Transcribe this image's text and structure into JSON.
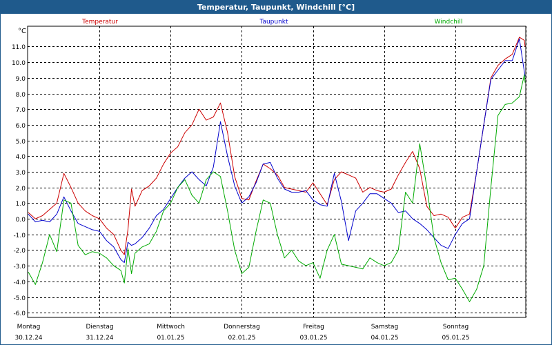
{
  "window": {
    "title": "Temperatur, Taupunkt, Windchill [°C]"
  },
  "chart_data": {
    "type": "line",
    "title": "Temperatur, Taupunkt, Windchill [°C]",
    "ylabel": "°C",
    "ylim": [
      -6.3,
      12.3
    ],
    "yticks": [
      11.0,
      10.0,
      9.0,
      8.0,
      7.0,
      6.0,
      5.0,
      4.0,
      3.0,
      2.0,
      1.0,
      0.0,
      -1.0,
      -2.0,
      -3.0,
      -4.0,
      -5.0,
      -6.0
    ],
    "xlim": [
      0,
      7
    ],
    "xticks": [
      {
        "x": 0,
        "day": "Montag",
        "date": "30.12.24"
      },
      {
        "x": 1,
        "day": "Dienstag",
        "date": "31.12.24"
      },
      {
        "x": 2,
        "day": "Mittwoch",
        "date": "01.01.25"
      },
      {
        "x": 3,
        "day": "Donnerstag",
        "date": "02.01.25"
      },
      {
        "x": 4,
        "day": "Freitag",
        "date": "03.01.25"
      },
      {
        "x": 5,
        "day": "Samstag",
        "date": "04.01.25"
      },
      {
        "x": 6,
        "day": "Sonntag",
        "date": "05.01.25"
      }
    ],
    "grid": true,
    "legend_position": "top",
    "series": [
      {
        "name": "Temperatur",
        "color": "#cc0000",
        "x": [
          0,
          0.1,
          0.2,
          0.3,
          0.4,
          0.5,
          0.6,
          0.7,
          0.8,
          0.9,
          1.0,
          1.1,
          1.2,
          1.3,
          1.35,
          1.4,
          1.45,
          1.5,
          1.6,
          1.7,
          1.8,
          1.9,
          2.0,
          2.1,
          2.2,
          2.3,
          2.4,
          2.5,
          2.6,
          2.7,
          2.8,
          2.9,
          3.0,
          3.1,
          3.2,
          3.3,
          3.4,
          3.5,
          3.6,
          3.7,
          3.8,
          3.9,
          4.0,
          4.1,
          4.2,
          4.3,
          4.4,
          4.5,
          4.6,
          4.7,
          4.8,
          4.9,
          5.0,
          5.1,
          5.2,
          5.3,
          5.4,
          5.5,
          5.6,
          5.7,
          5.8,
          5.9,
          6.0,
          6.1,
          6.2,
          6.3,
          6.4,
          6.5,
          6.6,
          6.7,
          6.8,
          6.9,
          6.97,
          7.0
        ],
        "values": [
          0.4,
          0.0,
          0.2,
          0.6,
          1.0,
          2.9,
          2.0,
          1.0,
          0.5,
          0.2,
          0.0,
          -0.6,
          -1.0,
          -2.0,
          -2.3,
          -0.7,
          1.9,
          0.8,
          1.8,
          2.1,
          2.6,
          3.5,
          4.2,
          4.6,
          5.5,
          6.0,
          7.0,
          6.3,
          6.5,
          7.4,
          5.5,
          2.7,
          1.3,
          1.2,
          2.4,
          3.5,
          3.2,
          2.8,
          2.0,
          1.9,
          1.8,
          1.7,
          2.3,
          1.6,
          0.9,
          2.5,
          3.0,
          2.8,
          2.6,
          1.7,
          2.0,
          1.8,
          1.7,
          1.9,
          2.8,
          3.6,
          4.3,
          3.2,
          0.8,
          0.2,
          0.3,
          0.1,
          -0.6,
          0.1,
          0.3,
          3.0,
          6.0,
          9.0,
          9.8,
          10.2,
          10.5,
          11.6,
          11.4,
          11.0
        ]
      },
      {
        "name": "Taupunkt",
        "color": "#0000cc",
        "x": [
          0,
          0.1,
          0.2,
          0.3,
          0.4,
          0.5,
          0.6,
          0.7,
          0.8,
          0.9,
          1.0,
          1.1,
          1.2,
          1.3,
          1.35,
          1.4,
          1.45,
          1.5,
          1.6,
          1.7,
          1.8,
          1.9,
          2.0,
          2.1,
          2.2,
          2.3,
          2.4,
          2.5,
          2.6,
          2.7,
          2.8,
          2.9,
          3.0,
          3.1,
          3.2,
          3.3,
          3.4,
          3.5,
          3.6,
          3.7,
          3.8,
          3.9,
          4.0,
          4.1,
          4.2,
          4.3,
          4.4,
          4.5,
          4.6,
          4.7,
          4.8,
          4.9,
          5.0,
          5.1,
          5.2,
          5.3,
          5.4,
          5.5,
          5.6,
          5.7,
          5.8,
          5.9,
          6.0,
          6.1,
          6.2,
          6.3,
          6.4,
          6.5,
          6.6,
          6.7,
          6.8,
          6.9,
          6.97,
          7.0
        ],
        "values": [
          0.3,
          -0.2,
          -0.1,
          -0.2,
          0.3,
          1.4,
          0.5,
          -0.3,
          -0.5,
          -0.7,
          -0.8,
          -1.4,
          -1.8,
          -2.6,
          -2.8,
          -1.5,
          -1.7,
          -1.6,
          -1.2,
          -0.6,
          0.2,
          0.6,
          1.3,
          2.0,
          2.6,
          3.0,
          2.5,
          2.1,
          3.3,
          6.2,
          4.0,
          2.1,
          1.0,
          1.4,
          2.3,
          3.5,
          3.6,
          2.6,
          1.9,
          1.7,
          1.7,
          1.8,
          1.2,
          0.9,
          0.8,
          2.9,
          1.1,
          -1.4,
          0.5,
          1.0,
          1.6,
          1.6,
          1.3,
          1.0,
          0.4,
          0.5,
          0.0,
          -0.3,
          -0.7,
          -1.2,
          -1.7,
          -1.9,
          -1.0,
          -0.3,
          0.0,
          3.0,
          6.0,
          8.9,
          9.5,
          10.1,
          10.1,
          11.5,
          9.4,
          9.1
        ]
      },
      {
        "name": "Windchill",
        "color": "#00aa00",
        "x": [
          0,
          0.1,
          0.2,
          0.3,
          0.4,
          0.5,
          0.6,
          0.7,
          0.8,
          0.9,
          1.0,
          1.1,
          1.2,
          1.3,
          1.35,
          1.4,
          1.45,
          1.5,
          1.6,
          1.7,
          1.8,
          1.9,
          2.0,
          2.1,
          2.2,
          2.3,
          2.4,
          2.5,
          2.6,
          2.7,
          2.8,
          2.9,
          3.0,
          3.1,
          3.2,
          3.3,
          3.4,
          3.5,
          3.6,
          3.7,
          3.8,
          3.9,
          4.0,
          4.1,
          4.2,
          4.3,
          4.4,
          4.5,
          4.6,
          4.7,
          4.8,
          4.9,
          5.0,
          5.1,
          5.2,
          5.3,
          5.4,
          5.5,
          5.6,
          5.7,
          5.8,
          5.9,
          6.0,
          6.1,
          6.2,
          6.3,
          6.4,
          6.5,
          6.6,
          6.7,
          6.8,
          6.9,
          6.97,
          7.0
        ],
        "values": [
          -3.4,
          -4.2,
          -2.8,
          -1.0,
          -2.1,
          1.2,
          1.0,
          -1.7,
          -2.3,
          -2.1,
          -2.2,
          -2.5,
          -3.0,
          -3.3,
          -4.1,
          -1.9,
          -3.5,
          -2.2,
          -1.8,
          -1.6,
          -0.8,
          0.5,
          1.0,
          2.0,
          2.5,
          1.5,
          1.0,
          2.5,
          3.0,
          2.7,
          0.5,
          -2.0,
          -3.5,
          -3.1,
          -0.8,
          1.2,
          1.0,
          -1.0,
          -2.5,
          -2.0,
          -2.7,
          -3.0,
          -2.8,
          -3.8,
          -2.0,
          -1.0,
          -2.9,
          -3.0,
          -3.1,
          -3.2,
          -2.5,
          -2.8,
          -3.0,
          -2.8,
          -2.0,
          1.7,
          1.0,
          4.8,
          2.0,
          -1.2,
          -2.8,
          -3.9,
          -3.8,
          -4.5,
          -5.3,
          -4.5,
          -3.0,
          2.0,
          6.6,
          7.3,
          7.4,
          7.8,
          9.2,
          8.7
        ]
      }
    ]
  }
}
